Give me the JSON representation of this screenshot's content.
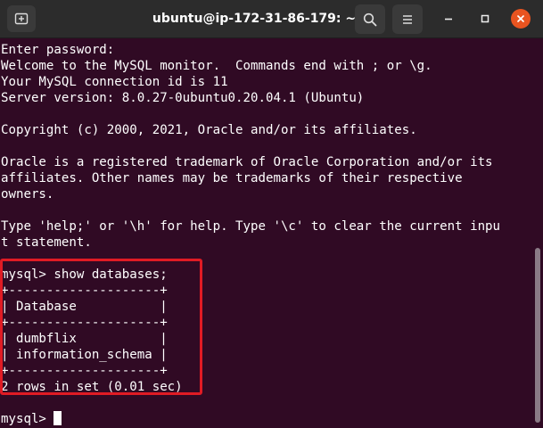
{
  "window": {
    "title": "ubuntu@ip-172-31-86-179: ~"
  },
  "icons": {
    "new_tab": "new-tab-icon",
    "search": "search-icon",
    "menu": "hamburger-menu-icon",
    "minimize": "minimize-icon",
    "maximize": "maximize-icon",
    "close": "close-icon"
  },
  "colors": {
    "terminal_bg": "#300a24",
    "titlebar_bg": "#2c2c2c",
    "text": "#ffffff",
    "close_button": "#e95420",
    "highlight_border": "#e01b24"
  },
  "terminal": {
    "lines": [
      "Enter password:",
      "Welcome to the MySQL monitor.  Commands end with ; or \\g.",
      "Your MySQL connection id is 11",
      "Server version: 8.0.27-0ubuntu0.20.04.1 (Ubuntu)",
      "",
      "Copyright (c) 2000, 2021, Oracle and/or its affiliates.",
      "",
      "Oracle is a registered trademark of Oracle Corporation and/or its",
      "affiliates. Other names may be trademarks of their respective",
      "owners.",
      "",
      "Type 'help;' or '\\h' for help. Type '\\c' to clear the current inpu",
      "t statement.",
      "",
      "mysql> show databases;",
      "+--------------------+",
      "| Database           |",
      "+--------------------+",
      "| dumbflix           |",
      "| information_schema |",
      "+--------------------+",
      "2 rows in set (0.01 sec)",
      ""
    ],
    "prompt": "mysql> "
  }
}
